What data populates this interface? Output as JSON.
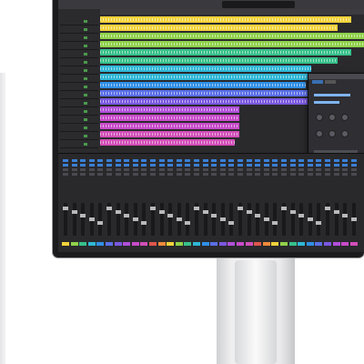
{
  "scene": {
    "description_colors": {
      "background": "#ffffff",
      "bezel": "#1b1b1d",
      "daw_bg": "#232326",
      "stand": "#eeeeef"
    }
  },
  "daw": {
    "lcd_text": "",
    "track_colors": [
      "#f2d23a",
      "#f2d23a",
      "#8fd14a",
      "#8fd14a",
      "#37c08a",
      "#37c08a",
      "#2fb7d6",
      "#2fb7d6",
      "#2f8fe6",
      "#5a6ee6",
      "#7a58e0",
      "#b04fd9",
      "#c84bc9",
      "#c84bc9",
      "#d24fb8",
      "#d24fb8"
    ],
    "mixer_colors": [
      "#f2d23a",
      "#8fd14a",
      "#37c08a",
      "#2fb7d6",
      "#2f8fe6",
      "#5a6ee6",
      "#7a58e0",
      "#b04fd9",
      "#c84bc9",
      "#d24fb8",
      "#e0564d",
      "#f08a3a"
    ]
  }
}
